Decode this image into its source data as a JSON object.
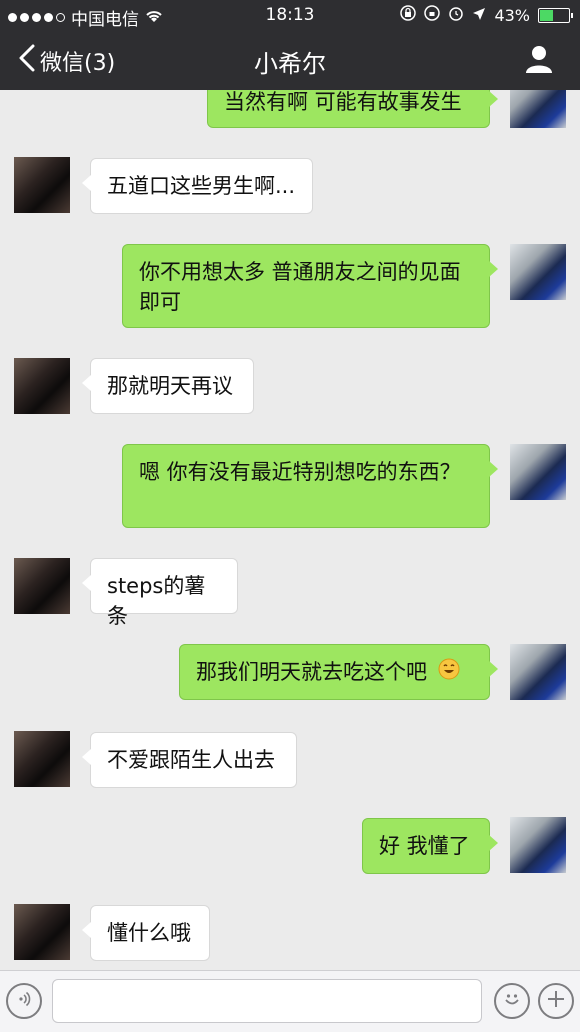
{
  "status_bar": {
    "carrier": "中国电信",
    "time": "18:13",
    "battery": "43%",
    "battery_level": 0.43
  },
  "nav": {
    "back_label": "微信(3)",
    "title": "小希尔"
  },
  "messages": [
    {
      "side": "out",
      "text": "当然有啊 可能有故事发生"
    },
    {
      "side": "in",
      "text": "五道口这些男生啊..."
    },
    {
      "side": "out",
      "text": "你不用想太多 普通朋友之间的见面即可"
    },
    {
      "side": "in",
      "text": "那就明天再议"
    },
    {
      "side": "out",
      "text": "嗯 你有没有最近特别想吃的东西？"
    },
    {
      "side": "in",
      "text": "steps的薯条"
    },
    {
      "side": "out",
      "text": "那我们明天就去吃这个吧"
    },
    {
      "side": "in",
      "text": "不爱跟陌生人出去"
    },
    {
      "side": "out",
      "text": "好 我懂了"
    },
    {
      "side": "in",
      "text": "懂什么哦"
    }
  ],
  "input": {
    "placeholder": ""
  }
}
